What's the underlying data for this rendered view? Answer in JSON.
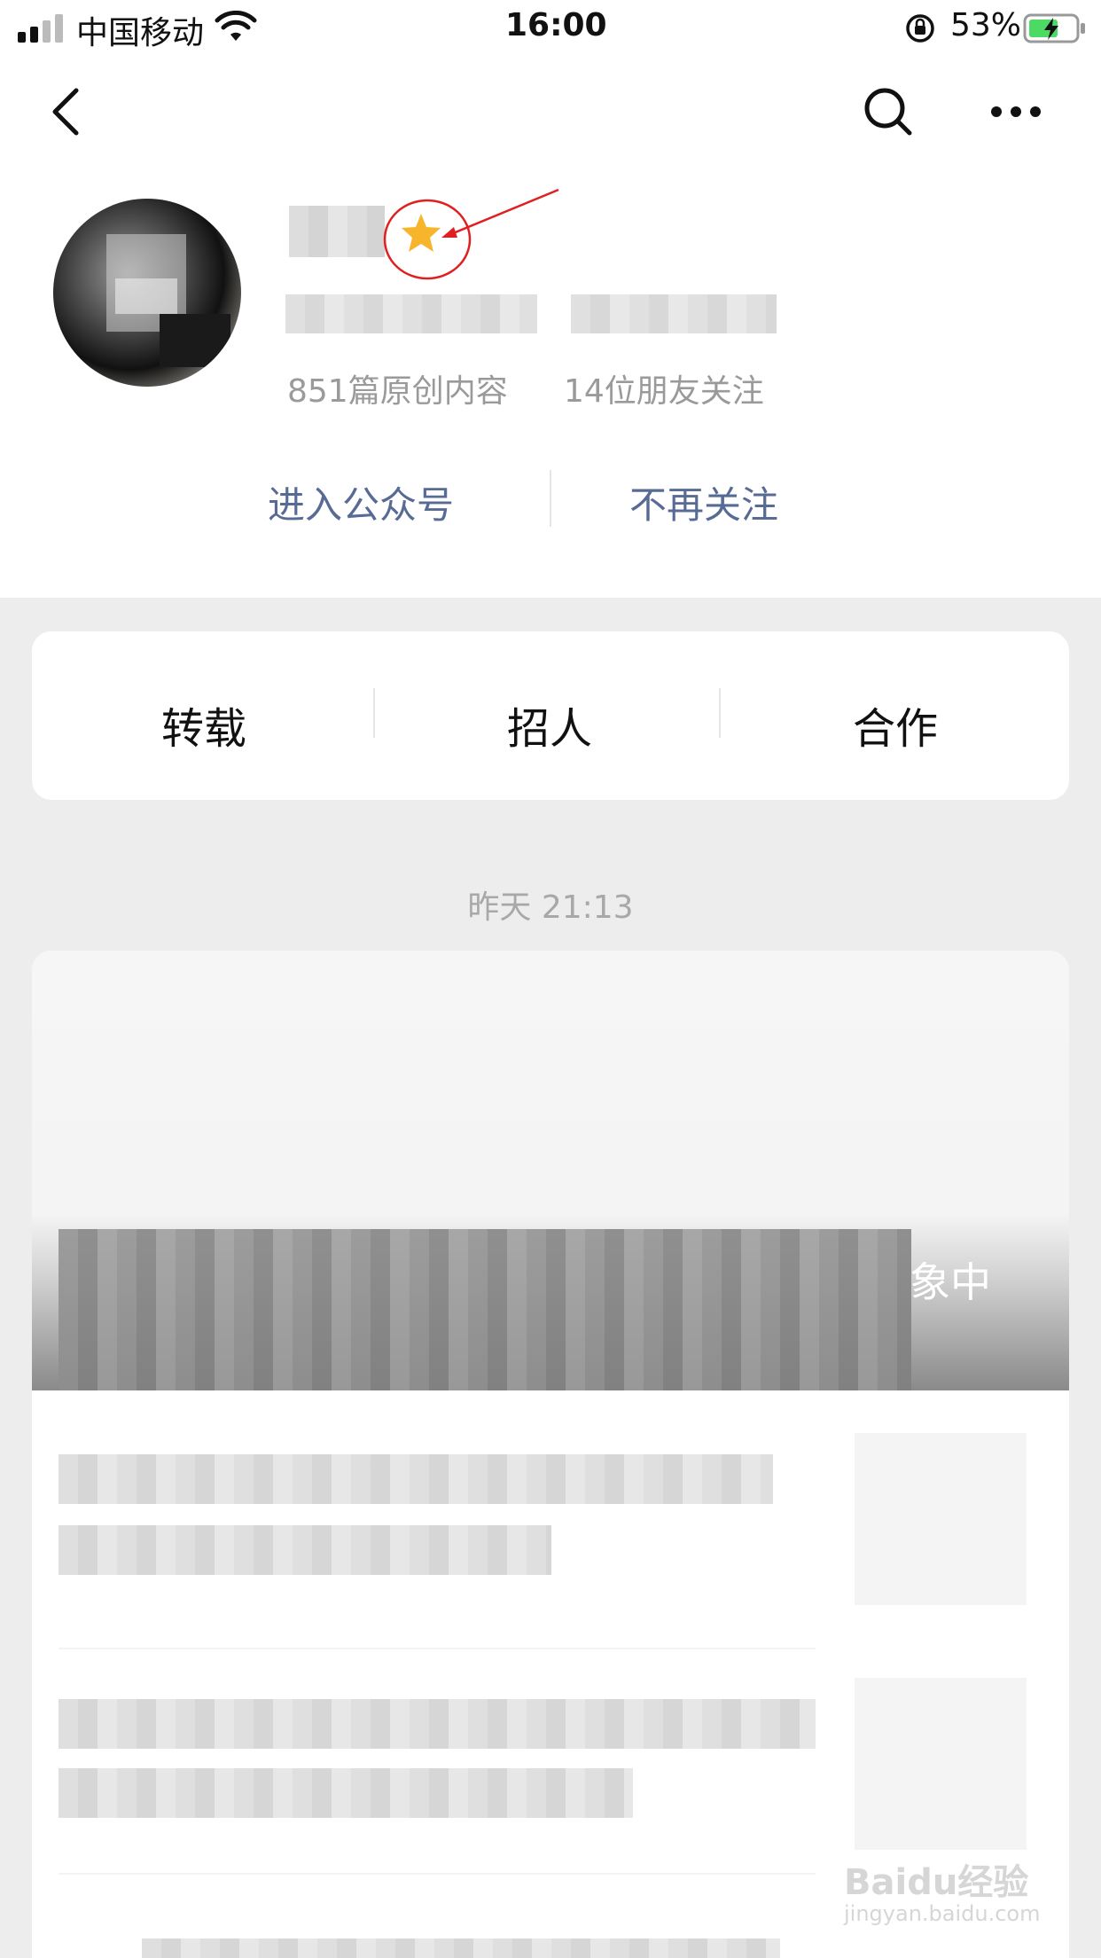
{
  "status_bar": {
    "carrier": "中国移动",
    "time": "16:00",
    "battery": "53%"
  },
  "profile": {
    "stats_original": "851篇原创内容",
    "stats_friends": "14位朋友关注"
  },
  "actions": {
    "enter": "进入公众号",
    "unfollow": "不再关注"
  },
  "menu": {
    "items": [
      {
        "label": "转载"
      },
      {
        "label": "招人"
      },
      {
        "label": "合作"
      }
    ]
  },
  "feed": {
    "timestamp": "昨天 21:13",
    "cover_title_visible": "象中"
  },
  "watermark": {
    "text": "Baidu经验",
    "url": "jingyan.baidu.com"
  },
  "colors": {
    "accent": "#576b95",
    "star": "#f7b52c",
    "annotation": "#e02020",
    "battery": "#4cd964"
  }
}
